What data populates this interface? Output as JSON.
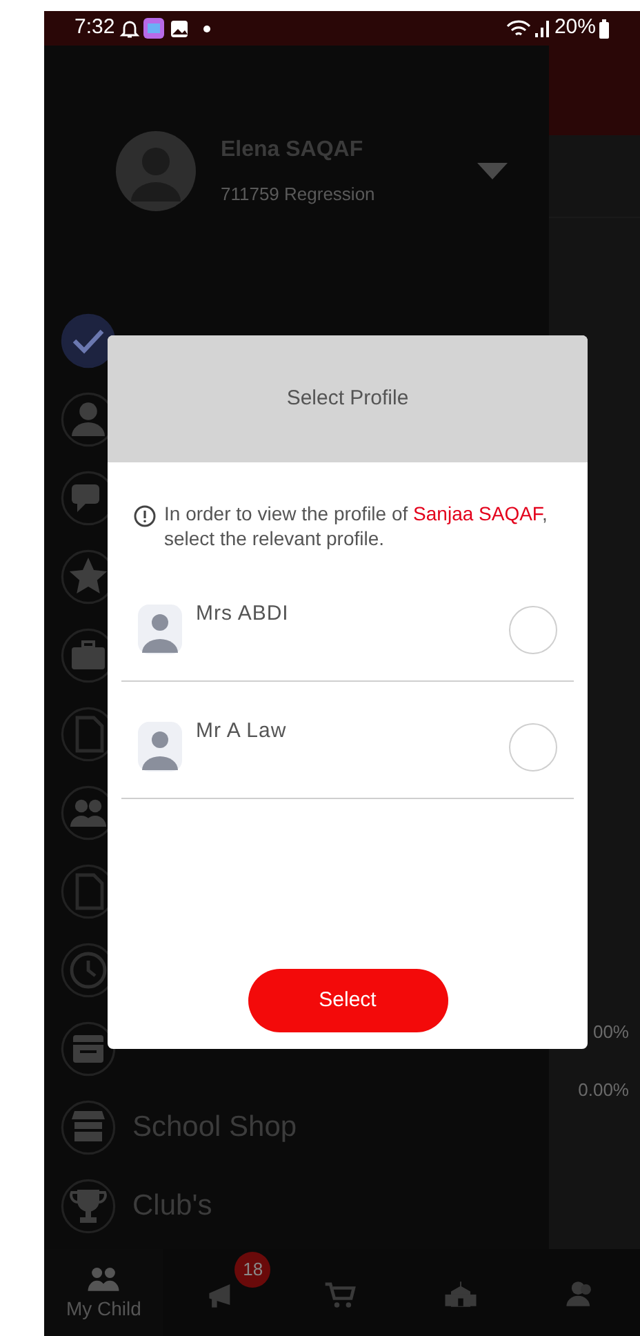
{
  "status_bar": {
    "time": "7:32",
    "battery": "20%"
  },
  "drawer": {
    "user": {
      "name": "Elena SAQAF",
      "subtitle": "711759 Regression"
    },
    "items": [
      {
        "kind": "check",
        "selected": true
      },
      {
        "kind": "person",
        "selected": false
      },
      {
        "kind": "chat",
        "selected": false
      },
      {
        "kind": "star",
        "selected": false
      },
      {
        "kind": "briefcase",
        "selected": false
      },
      {
        "kind": "document",
        "selected": false
      },
      {
        "kind": "group",
        "selected": false
      },
      {
        "kind": "document",
        "selected": false
      },
      {
        "kind": "clock",
        "selected": false
      },
      {
        "kind": "calendar",
        "selected": false
      },
      {
        "kind": "shop",
        "label": "School Shop",
        "selected": false
      },
      {
        "kind": "trophy",
        "label": "Club's",
        "selected": false
      }
    ]
  },
  "background_values": [
    "00%",
    "0.00%"
  ],
  "dialog": {
    "title": "Select Profile",
    "info": {
      "before": "In order to view the profile of ",
      "name": "Sanjaa SAQAF",
      "after": ", select the relevant profile."
    },
    "profiles": [
      {
        "name": "Mrs ABDI",
        "selected": false
      },
      {
        "name": "Mr A Law",
        "selected": false
      }
    ],
    "button": "Select"
  },
  "bottom_nav": [
    {
      "kind": "child",
      "label": "My Child",
      "selected": true
    },
    {
      "kind": "megaphone",
      "badge": "18",
      "selected": false
    },
    {
      "kind": "cart",
      "selected": false
    },
    {
      "kind": "school",
      "selected": false
    },
    {
      "kind": "staff",
      "selected": false
    }
  ]
}
